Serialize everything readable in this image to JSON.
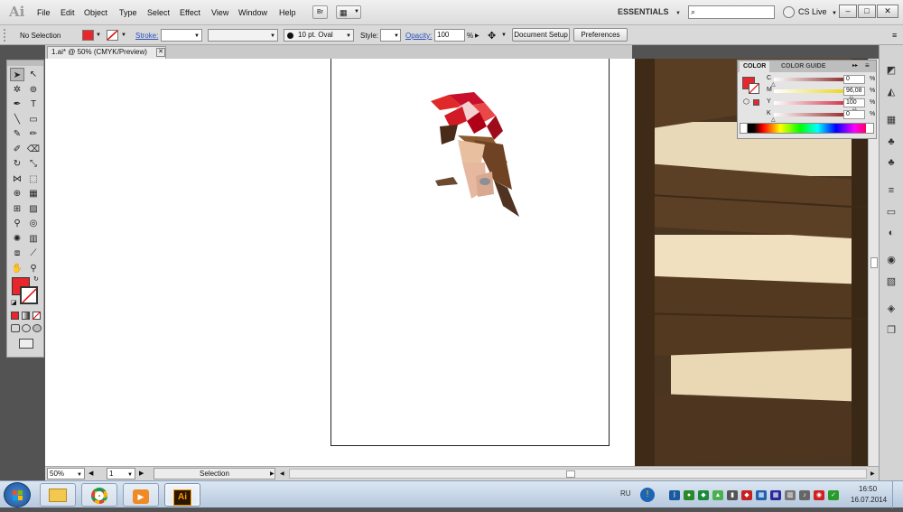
{
  "app": {
    "logo": "Ai"
  },
  "menu": [
    "File",
    "Edit",
    "Object",
    "Type",
    "Select",
    "Effect",
    "View",
    "Window",
    "Help"
  ],
  "menubar_right": {
    "bridge": "Br",
    "workspace": "ESSENTIALS",
    "cs_live": "CS Live"
  },
  "window_buttons": [
    "–",
    "□",
    "✕"
  ],
  "control": {
    "selection": "No Selection",
    "stroke_label": "Stroke:",
    "brush": "10 pt. Oval",
    "style_label": "Style:",
    "opacity_label": "Opacity:",
    "opacity_value": "100",
    "opacity_unit": "%",
    "document_setup": "Document Setup",
    "preferences": "Preferences"
  },
  "document": {
    "tab_title": "1.ai* @ 50% (CMYK/Preview)",
    "tab_close": "✕"
  },
  "status": {
    "zoom": "50%",
    "page": "1",
    "tool": "Selection"
  },
  "color_panel": {
    "tabs": [
      "COLOR",
      "COLOR GUIDE"
    ],
    "channels": [
      {
        "label": "C",
        "value": "0",
        "unit": "%",
        "level": 0,
        "color": "#7a1010"
      },
      {
        "label": "M",
        "value": "96,08",
        "unit": "%",
        "level": 0.96,
        "color": "#e8d000"
      },
      {
        "label": "Y",
        "value": "100",
        "unit": "%",
        "level": 1,
        "color": "#cc1830"
      },
      {
        "label": "K",
        "value": "0",
        "unit": "%",
        "level": 0,
        "color": "#8a1010"
      }
    ],
    "fill_color": "#e8262b"
  },
  "fill_swatch_color": "#e8262b",
  "taskbar": {
    "lang": "RU",
    "time": "16:50",
    "date": "16.07.2014",
    "ai_label": "Ai"
  }
}
